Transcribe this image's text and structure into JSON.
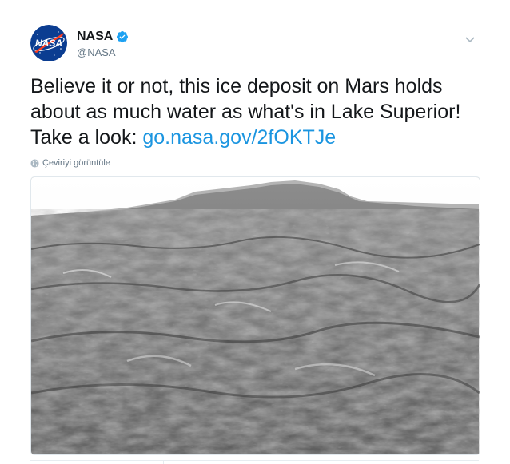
{
  "tweet": {
    "display_name": "NASA",
    "handle": "@NASA",
    "text_before_link": "Believe it or not, this ice deposit on Mars holds about as much water as what's in Lake Superior! Take a look: ",
    "link_text": "go.nasa.gov/2fOKTJe",
    "translate_label": "Çeviriyi görüntüle",
    "verified": true
  },
  "icons": {
    "avatar": "nasa-logo-icon",
    "verified": "verified-badge-icon",
    "dropdown": "chevron-down-icon",
    "globe": "globe-icon"
  },
  "colors": {
    "link": "#1b95e0",
    "verified": "#1da1f2",
    "secondary_text": "#657786",
    "nasa_blue": "#0b3d91",
    "nasa_red": "#fc3d21"
  }
}
